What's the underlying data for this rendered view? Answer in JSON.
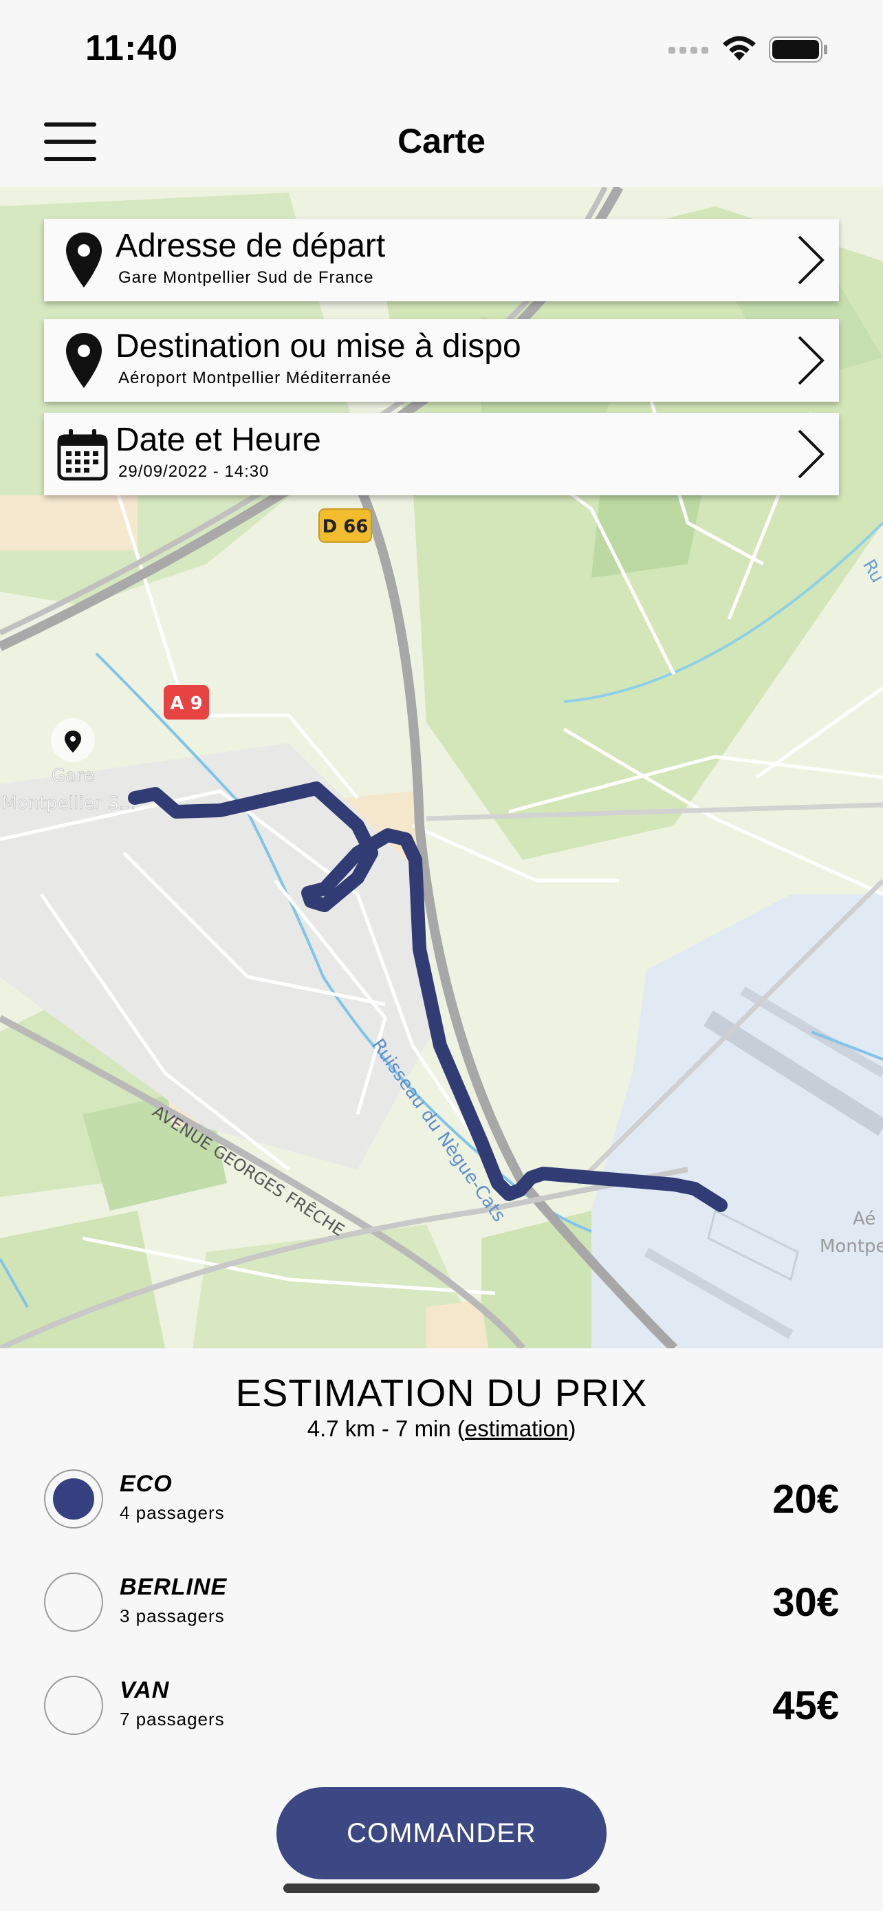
{
  "status": {
    "time": "11:40"
  },
  "header": {
    "title": "Carte"
  },
  "map": {
    "road_labels": [
      "D 66",
      "A 9"
    ],
    "station_label_1": "Gare",
    "station_label_2": "Montpellier S...",
    "street_label": "AVENUE GEORGES FRÊCHE",
    "stream_label": "Ruisseau du Nègue-Cats",
    "airport_label_1": "Aé",
    "airport_label_2": "Montpe",
    "edge_label": "Ru",
    "route_color": "#313c74"
  },
  "cards": {
    "departure": {
      "title": "Adresse de départ",
      "subtitle": "Gare Montpellier Sud de France"
    },
    "destination": {
      "title": "Destination ou mise à dispo",
      "subtitle": "Aéroport Montpellier Méditerranée"
    },
    "datetime": {
      "title": "Date et Heure",
      "subtitle": "29/09/2022 - 14:30"
    }
  },
  "estimation": {
    "title": "ESTIMATION DU PRIX",
    "summary": "4.7 km - 7 min (",
    "summary_link": "estimation",
    "summary_end": ")",
    "options": [
      {
        "name": "ECO",
        "passengers": "4 passagers",
        "price": "20€",
        "selected": true
      },
      {
        "name": "BERLINE",
        "passengers": "3 passagers",
        "price": "30€",
        "selected": false
      },
      {
        "name": "VAN",
        "passengers": "7 passagers",
        "price": "45€",
        "selected": false
      }
    ]
  },
  "order_button": {
    "label": "COMMANDER"
  },
  "colors": {
    "accent": "#3b4884",
    "selected_radio": "#354080"
  }
}
